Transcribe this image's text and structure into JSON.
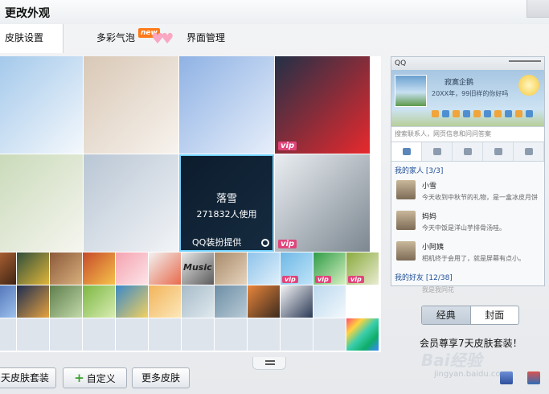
{
  "window": {
    "title": "更改外观"
  },
  "tabs": [
    {
      "label": "皮肤设置",
      "active": true
    },
    {
      "label": "多彩气泡",
      "badge": "new"
    },
    {
      "label": "界面管理"
    }
  ],
  "skins": {
    "large_tiles": [
      {
        "name": "sky-clouds",
        "colors": [
          "#9fc6ea",
          "#f4f8fc"
        ]
      },
      {
        "name": "winter-path",
        "colors": [
          "#d9c8b6",
          "#f7f3ee"
        ]
      },
      {
        "name": "bird-branch",
        "colors": [
          "#8fb2e4",
          "#e6eefa"
        ]
      },
      {
        "name": "snow-doll-red-hood",
        "colors": [
          "#223047",
          "#e7292d"
        ],
        "vip": "vip"
      },
      {
        "name": "snowmen",
        "colors": [
          "#c7d8b6",
          "#f6f6f0"
        ]
      },
      {
        "name": "snow-forest",
        "colors": [
          "#b9c6d4",
          "#f2f4f7"
        ]
      },
      {
        "name": "selected-snow",
        "colors": [
          "#1b2633",
          "#32495e"
        ],
        "selected": true
      },
      {
        "name": "pagoda-snow",
        "colors": [
          "#eaeef2",
          "#7c8790"
        ],
        "vip": "vip"
      }
    ],
    "selected_overlay": {
      "name": "落雪",
      "users": "271832人使用",
      "provider": "QQ装扮提供"
    },
    "small_tiles_row1": [
      {
        "colors": [
          "#c9723b",
          "#3f2414"
        ]
      },
      {
        "colors": [
          "#2f4e3a",
          "#e0b63a"
        ]
      },
      {
        "colors": [
          "#8b5a3b",
          "#d9b07c"
        ]
      },
      {
        "colors": [
          "#c64a2a",
          "#f6c24b"
        ]
      },
      {
        "colors": [
          "#f4a3b0",
          "#fde4e8"
        ]
      },
      {
        "colors": [
          "#f2f2f2",
          "#e86a4c"
        ]
      },
      {
        "colors": [
          "#e8e8e8",
          "#5b5b5b"
        ],
        "label": "Music"
      },
      {
        "colors": [
          "#a88b6b",
          "#e6d3bd"
        ]
      },
      {
        "colors": [
          "#8fc3ea",
          "#dff0fb"
        ]
      },
      {
        "colors": [
          "#6fb8e6",
          "#bfe4f8"
        ],
        "vip": "vip"
      },
      {
        "colors": [
          "#2f9c47",
          "#d7f0c2"
        ],
        "vip": "vip"
      },
      {
        "colors": [
          "#8aaa3e",
          "#e9ecd1"
        ],
        "vip": "vip"
      }
    ],
    "small_tiles_row2": [
      {
        "colors": [
          "#3c5fa8",
          "#9ec2ee"
        ]
      },
      {
        "colors": [
          "#1b2c52",
          "#e6a33e"
        ]
      },
      {
        "colors": [
          "#5f7e4d",
          "#c2d9a9"
        ]
      },
      {
        "colors": [
          "#7cb742",
          "#d8ecb2"
        ]
      },
      {
        "colors": [
          "#3a88c8",
          "#f2d15f"
        ]
      },
      {
        "colors": [
          "#f2b45a",
          "#fce7b9"
        ]
      },
      {
        "colors": [
          "#a7bcc9",
          "#dfe8ee"
        ]
      },
      {
        "colors": [
          "#6d8ea5",
          "#b8cad6"
        ]
      },
      {
        "colors": [
          "#e9863b",
          "#3c2a1e"
        ]
      },
      {
        "colors": [
          "#f5f5f5",
          "#2b3a57"
        ]
      },
      {
        "colors": [
          "#bcd9ee",
          "#f2f8fc"
        ]
      }
    ],
    "rainbow_tile": {
      "colors": [
        "#ff4d6d",
        "#ffd23f",
        "#3bceac",
        "#0ead69",
        "#3a86ff"
      ]
    }
  },
  "preview": {
    "window_title": "QQ",
    "nickname": "寂寞企鹅",
    "signature": "20XX年，99旧样的你好吗",
    "search_placeholder": "搜索联系人，网页信息和问问答案",
    "groups": [
      {
        "label": "我的家人  [3/3]"
      },
      {
        "label": "我的好友  [12/38]"
      }
    ],
    "contacts": [
      {
        "name": "小雪",
        "message": "今天收到中秋节的礼物，是一盒冰皮月饼"
      },
      {
        "name": "妈妈",
        "message": "今天中饭是洋山芋排骨汤哇。"
      },
      {
        "name": "小阿姨",
        "message": "相机终于会用了，就是屏幕有点小。"
      }
    ],
    "faded_item": "我是我同花"
  },
  "mode_switch": {
    "classic": "经典",
    "cover": "封面"
  },
  "promo_text": "会员尊享7天皮肤套装！",
  "bottom_buttons": {
    "skin_pack": "天皮肤套装",
    "customize": "自定义",
    "more_skins": "更多皮肤"
  },
  "watermark": {
    "main": "Bai经验",
    "sub": "jingyan.baidu.com"
  }
}
